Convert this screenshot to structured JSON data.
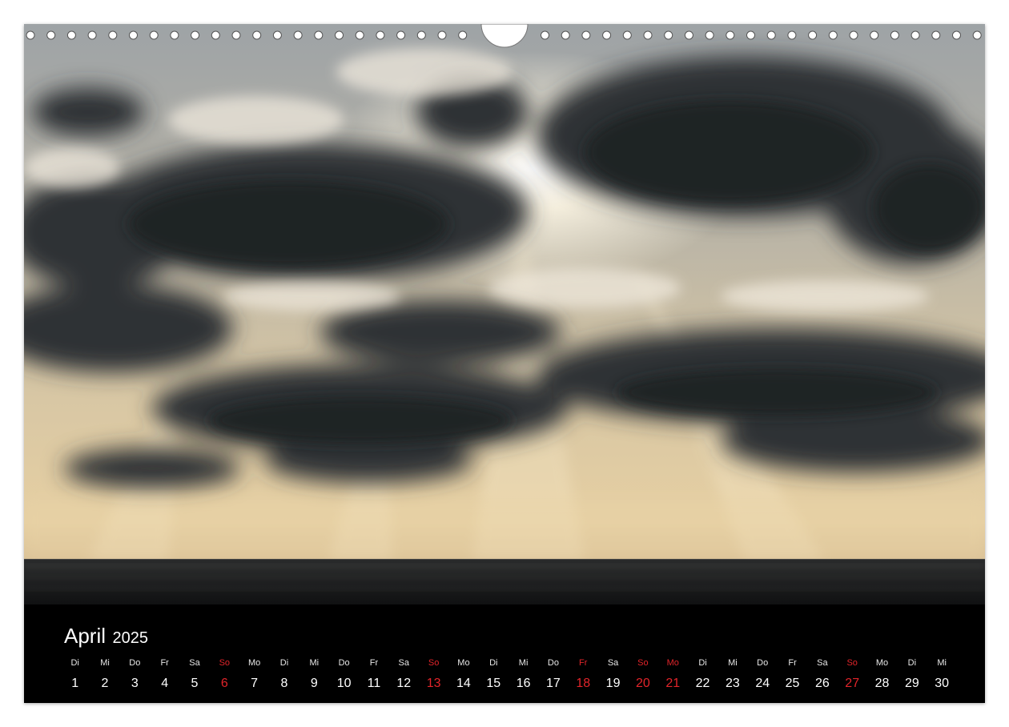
{
  "calendar": {
    "month": "April",
    "year": "2025",
    "days": [
      {
        "dow": "Di",
        "num": "1",
        "red": false
      },
      {
        "dow": "Mi",
        "num": "2",
        "red": false
      },
      {
        "dow": "Do",
        "num": "3",
        "red": false
      },
      {
        "dow": "Fr",
        "num": "4",
        "red": false
      },
      {
        "dow": "Sa",
        "num": "5",
        "red": false
      },
      {
        "dow": "So",
        "num": "6",
        "red": true
      },
      {
        "dow": "Mo",
        "num": "7",
        "red": false
      },
      {
        "dow": "Di",
        "num": "8",
        "red": false
      },
      {
        "dow": "Mi",
        "num": "9",
        "red": false
      },
      {
        "dow": "Do",
        "num": "10",
        "red": false
      },
      {
        "dow": "Fr",
        "num": "11",
        "red": false
      },
      {
        "dow": "Sa",
        "num": "12",
        "red": false
      },
      {
        "dow": "So",
        "num": "13",
        "red": true
      },
      {
        "dow": "Mo",
        "num": "14",
        "red": false
      },
      {
        "dow": "Di",
        "num": "15",
        "red": false
      },
      {
        "dow": "Mi",
        "num": "16",
        "red": false
      },
      {
        "dow": "Do",
        "num": "17",
        "red": false
      },
      {
        "dow": "Fr",
        "num": "18",
        "red": true
      },
      {
        "dow": "Sa",
        "num": "19",
        "red": false
      },
      {
        "dow": "So",
        "num": "20",
        "red": true
      },
      {
        "dow": "Mo",
        "num": "21",
        "red": true
      },
      {
        "dow": "Di",
        "num": "22",
        "red": false
      },
      {
        "dow": "Mi",
        "num": "23",
        "red": false
      },
      {
        "dow": "Do",
        "num": "24",
        "red": false
      },
      {
        "dow": "Fr",
        "num": "25",
        "red": false
      },
      {
        "dow": "Sa",
        "num": "26",
        "red": false
      },
      {
        "dow": "So",
        "num": "27",
        "red": true
      },
      {
        "dow": "Mo",
        "num": "28",
        "red": false
      },
      {
        "dow": "Di",
        "num": "29",
        "red": false
      },
      {
        "dow": "Mi",
        "num": "30",
        "red": false
      }
    ]
  },
  "colors": {
    "holiday_red": "#e2242a",
    "footer_bg": "#000000",
    "text": "#ffffff"
  }
}
